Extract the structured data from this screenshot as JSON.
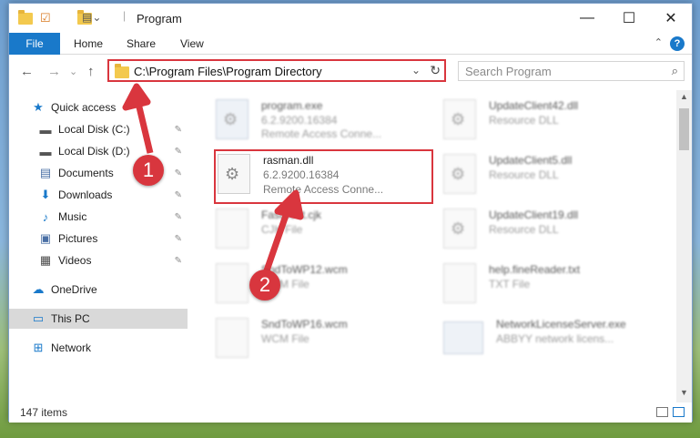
{
  "window": {
    "title": "Program",
    "controls": {
      "minimize": "—",
      "maximize": "☐",
      "close": "✕"
    }
  },
  "ribbon": {
    "tabs": [
      "File",
      "Home",
      "Share",
      "View"
    ],
    "help_label": "?",
    "collapse_label": "⌃"
  },
  "nav": {
    "back": "←",
    "forward": "→",
    "dropdown": "⌄",
    "up": "↑"
  },
  "address": {
    "path": "C:\\Program Files\\Program Directory",
    "dropdown": "⌄",
    "refresh": "↻"
  },
  "search": {
    "placeholder": "Search Program",
    "icon": "⌕"
  },
  "sidebar": {
    "items": [
      {
        "label": "Quick access",
        "icon": "star-icon",
        "glyph": "★",
        "color": "#1979ca",
        "pinned": false
      },
      {
        "label": "Local Disk (C:)",
        "icon": "disk-icon",
        "glyph": "▬",
        "color": "#555555",
        "pinned": true
      },
      {
        "label": "Local Disk (D:)",
        "icon": "disk-icon",
        "glyph": "▬",
        "color": "#555555",
        "pinned": true
      },
      {
        "label": "Documents",
        "icon": "document-icon",
        "glyph": "▤",
        "color": "#4a6fa5",
        "pinned": true
      },
      {
        "label": "Downloads",
        "icon": "download-icon",
        "glyph": "⬇",
        "color": "#1979ca",
        "pinned": true
      },
      {
        "label": "Music",
        "icon": "music-icon",
        "glyph": "♪",
        "color": "#1979ca",
        "pinned": true
      },
      {
        "label": "Pictures",
        "icon": "pictures-icon",
        "glyph": "▣",
        "color": "#4a6fa5",
        "pinned": true
      },
      {
        "label": "Videos",
        "icon": "videos-icon",
        "glyph": "▦",
        "color": "#4a4a4a",
        "pinned": true
      },
      {
        "label": "OneDrive",
        "icon": "cloud-icon",
        "glyph": "☁",
        "color": "#1979ca",
        "pinned": false
      },
      {
        "label": "This PC",
        "icon": "computer-icon",
        "glyph": "▭",
        "color": "#1979ca",
        "pinned": false,
        "selected": true
      },
      {
        "label": "Network",
        "icon": "network-icon",
        "glyph": "⊞",
        "color": "#1979ca",
        "pinned": false
      }
    ],
    "pin_glyph": "📌"
  },
  "files": [
    {
      "name": "program.exe",
      "line2": "6.2.9200.16384",
      "line3": "Remote Access Conne...",
      "kind": "exe",
      "blurred": true
    },
    {
      "name": "UpdateClient42.dll",
      "line2": "Resource DLL",
      "line3": "",
      "kind": "dll",
      "blurred": true
    },
    {
      "name": "rasman.dll",
      "line2": "6.2.9200.16384",
      "line3": "Remote Access Conne...",
      "kind": "dll",
      "blurred": false,
      "highlighted": true
    },
    {
      "name": "UpdateClient5.dll",
      "line2": "Resource DLL",
      "line3": "",
      "kind": "dll",
      "blurred": true
    },
    {
      "name": "FastBoot.cjk",
      "line2": "CJK File",
      "line3": "",
      "kind": "doc",
      "blurred": true
    },
    {
      "name": "UpdateClient19.dll",
      "line2": "Resource DLL",
      "line3": "",
      "kind": "dll",
      "blurred": true
    },
    {
      "name": "SndToWP12.wcm",
      "line2": "WCM File",
      "line3": "",
      "kind": "doc",
      "blurred": true
    },
    {
      "name": "help.fineReader.txt",
      "line2": "TXT File",
      "line3": "",
      "kind": "doc",
      "blurred": true
    },
    {
      "name": "SndToWP16.wcm",
      "line2": "WCM File",
      "line3": "",
      "kind": "doc",
      "blurred": true
    },
    {
      "name": "NetworkLicenseServer.exe",
      "line2": "ABBYY network licens...",
      "line3": "",
      "kind": "exe",
      "blurred": true
    }
  ],
  "gear_glyph": "⚙",
  "status": {
    "item_count": "147 items"
  },
  "callouts": [
    {
      "number": "1"
    },
    {
      "number": "2"
    }
  ],
  "accent_color": "#d9363e"
}
